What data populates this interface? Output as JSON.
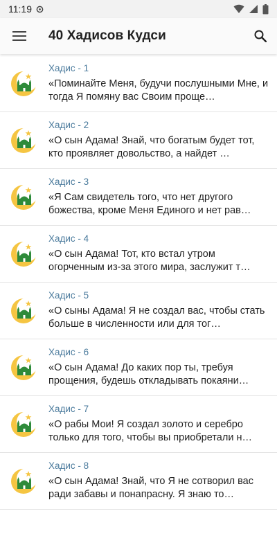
{
  "status": {
    "time": "11:19"
  },
  "app_bar": {
    "title": "40 Хадисов Кудси"
  },
  "items": [
    {
      "label": "Хадис - 1",
      "text": "«Поминайте Меня, будучи послушными Мне, и тогда Я помяну вас Своим проще…"
    },
    {
      "label": "Хадис - 2",
      "text": "«О сын Адама! Знай, что богатым будет тот, кто проявляет довольство, а найдет …"
    },
    {
      "label": "Хадис - 3",
      "text": "«Я Сам свидетель того, что нет другого божества, кроме Меня Единого и нет рав…"
    },
    {
      "label": "Хадис - 4",
      "text": "«О сын Адама! Тот, кто встал утром огорченным из-за этого мира, заслужит т…"
    },
    {
      "label": "Хадис - 5",
      "text": "«О сыны Адама! Я не создал вас, чтобы стать больше в численности или для тог…"
    },
    {
      "label": "Хадис - 6",
      "text": "«О сын Адама! До каких пор ты, требуя прощения, будешь откладывать покаяни…"
    },
    {
      "label": "Хадис - 7",
      "text": "«О рабы Мои! Я создал золото и серебро только для того, чтобы вы приобретали н…"
    },
    {
      "label": "Хадис - 8",
      "text": "«О сын Адама! Знай, что Я не сотворил вас ради забавы и понапрасну. Я знаю то…"
    }
  ],
  "icons": {
    "menu": "menu-icon",
    "search": "search-icon",
    "list": "mosque-crescent-icon"
  },
  "colors": {
    "accent_text": "#4a7a9c",
    "crescent": "#f5c542",
    "mosque": "#2e8b3a"
  }
}
